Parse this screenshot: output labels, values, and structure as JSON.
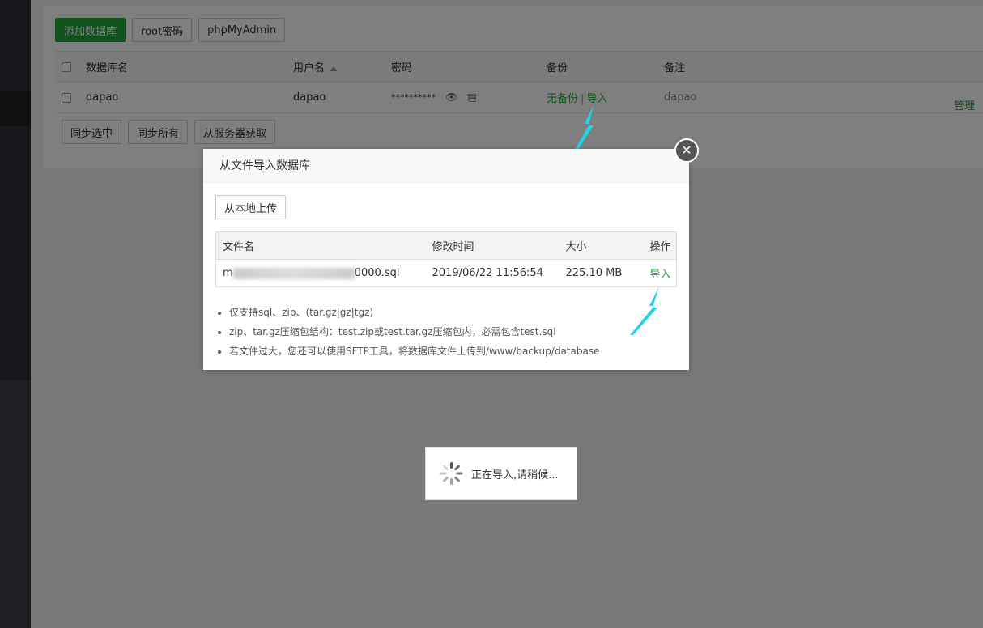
{
  "toolbar": {
    "add_db": "添加数据库",
    "root_pwd": "root密码",
    "phpmyadmin": "phpMyAdmin"
  },
  "db_table": {
    "headers": [
      "数据库名",
      "用户名",
      "密码",
      "备份",
      "备注"
    ],
    "rows": [
      {
        "name": "dapao",
        "user": "dapao",
        "password": "**********",
        "backup_none": "无备份",
        "backup_import": "导入",
        "note": "dapao",
        "manage": "管理"
      }
    ]
  },
  "bottom_bar": {
    "sync_selected": "同步选中",
    "sync_all": "同步所有",
    "fetch_server": "从服务器获取"
  },
  "dialog": {
    "title": "从文件导入数据库",
    "upload_local": "从本地上传",
    "file_headers": [
      "文件名",
      "修改时间",
      "大小",
      "操作"
    ],
    "files": [
      {
        "name_prefix": "m",
        "name_suffix": "0000.sql",
        "mtime": "2019/06/22 11:56:54",
        "size": "225.10 MB",
        "action": "导入"
      }
    ],
    "notes": [
      "仅支持sql、zip、(tar.gz|gz|tgz)",
      "zip、tar.gz压缩包结构：test.zip或test.tar.gz压缩包内，必需包含test.sql",
      "若文件过大，您还可以使用SFTP工具，将数据库文件上传到/www/backup/database"
    ]
  },
  "loading": {
    "text": "正在导入,请稍候..."
  },
  "icons": {
    "close": "close-icon",
    "eye": "eye-icon",
    "copy": "copy-icon",
    "spinner": "spinner-icon",
    "sort": "sort-up-icon"
  },
  "colors": {
    "accent": "#20a53a",
    "arrow": "#1fd4e8"
  }
}
